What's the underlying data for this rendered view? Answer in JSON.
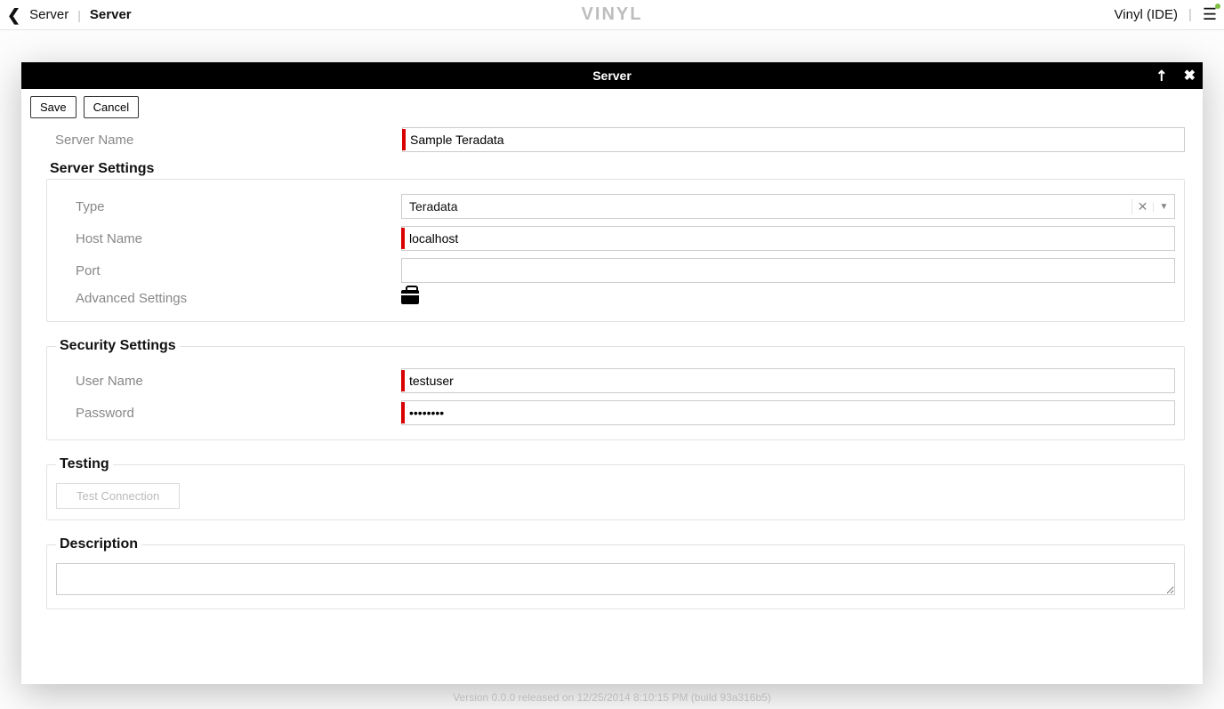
{
  "topbar": {
    "back_label": "Server",
    "current_label": "Server",
    "brand": "VINYL",
    "right_label": "Vinyl (IDE)"
  },
  "modal": {
    "title": "Server",
    "save_label": "Save",
    "cancel_label": "Cancel"
  },
  "form": {
    "server_name_label": "Server Name",
    "server_name_value": "Sample Teradata",
    "server_settings_legend": "Server Settings",
    "type_label": "Type",
    "type_value": "Teradata",
    "host_name_label": "Host Name",
    "host_name_value": "localhost",
    "port_label": "Port",
    "port_value": "",
    "advanced_label": "Advanced Settings",
    "security_legend": "Security Settings",
    "user_name_label": "User Name",
    "user_name_value": "testuser",
    "password_label": "Password",
    "password_value": "••••••••",
    "testing_legend": "Testing",
    "test_btn_label": "Test Connection",
    "description_legend": "Description",
    "description_value": ""
  },
  "footer": {
    "version_text": "Version 0.0.0 released on 12/25/2014 8:10:15 PM (build 93a316b5)"
  }
}
